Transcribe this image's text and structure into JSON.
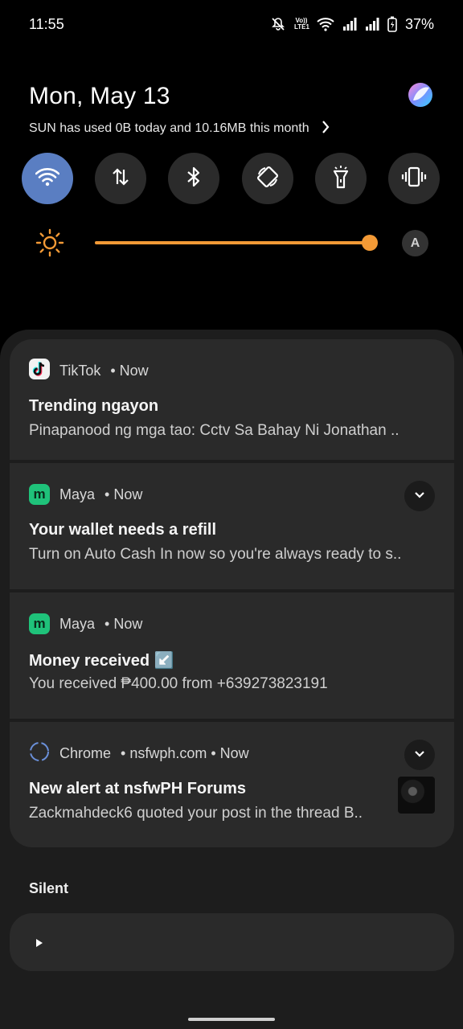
{
  "status_bar": {
    "time": "11:55",
    "volte_label": "Vo)) LTE1",
    "battery": "37%"
  },
  "header": {
    "date": "Mon, May 13",
    "data_usage": "SUN has used 0B today and 10.16MB this month"
  },
  "quick_settings": [
    {
      "name": "wifi",
      "icon": "wifi-icon",
      "active": true
    },
    {
      "name": "mobile-data",
      "icon": "data-transfer-icon",
      "active": false
    },
    {
      "name": "bluetooth",
      "icon": "bluetooth-icon",
      "active": false
    },
    {
      "name": "auto-rotate",
      "icon": "rotate-icon",
      "active": false
    },
    {
      "name": "flashlight",
      "icon": "flashlight-icon",
      "active": false
    },
    {
      "name": "vibrate",
      "icon": "vibrate-icon",
      "active": false
    }
  ],
  "brightness": {
    "level": 1.0,
    "auto_label": "A",
    "accent": "#f39a36"
  },
  "notifications": [
    {
      "app": "TikTok",
      "meta": "• Now",
      "title": "Trending ngayon",
      "text": "Pinapanood ng mga tao: Cctv Sa Bahay Ni Jonathan .."
    },
    {
      "app": "Maya",
      "meta": "• Now",
      "title": "Your wallet needs a refill",
      "text": "Turn on Auto Cash In now so you're always ready to s.."
    },
    {
      "app": "Maya",
      "meta": "• Now",
      "title": "Money received ↙️",
      "text": "You received ₱400.00 from +639273823191"
    },
    {
      "app": "Chrome",
      "meta": "• nsfwph.com • Now",
      "title": "New alert at nsfwPH Forums",
      "text": "Zackmahdeck6 quoted your post in the thread B.."
    }
  ],
  "silent": {
    "label": "Silent"
  },
  "colors": {
    "background": "#000000",
    "panel": "#1d1d1d",
    "card": "#2a2a2a",
    "qs_active": "#5a7ec2",
    "maya_green": "#1fc27a"
  }
}
